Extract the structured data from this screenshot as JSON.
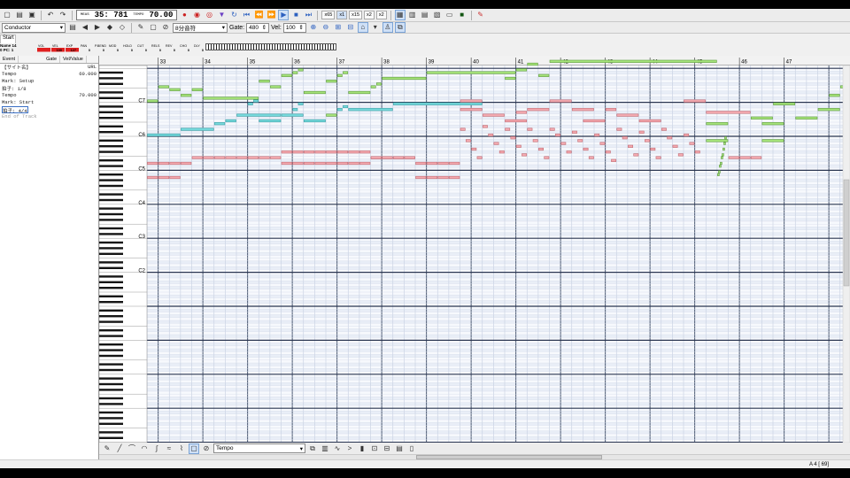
{
  "toolbar": {
    "meas_label": "MEAS",
    "position": "35: 781",
    "tempo_label": "TEMPO",
    "tempo": "70.00",
    "zoom_buttons": [
      "x65",
      "x1",
      "x15",
      "x2",
      "x2"
    ],
    "record_color": "#cc2222"
  },
  "toolbar2": {
    "track_select": "Conductor",
    "note_length": "8分音符",
    "gate_label": "Gate:",
    "gate_value": "480",
    "vel_label": "Vel:",
    "vel_value": "100"
  },
  "tabs": {
    "start": "Start"
  },
  "track_info": {
    "name_label": "Name 14",
    "port_label": "0 PC:",
    "port_value": "1",
    "columns": [
      "VOL",
      "VEL",
      "EXP",
      "PAN",
      "P.BEND",
      "MOD",
      "HOLD",
      "CUT",
      "RELS",
      "REV",
      "CHO",
      "DLY"
    ],
    "values": [
      "",
      "100",
      "127",
      "0",
      "0",
      "0",
      "0",
      "0",
      "0",
      "0",
      "0",
      "0"
    ],
    "accent": "#e02020"
  },
  "event_list": {
    "headers": [
      "Event",
      "Gate",
      "Vel/Value"
    ],
    "events": [
      {
        "name": "【サイト名】",
        "value": "URL"
      },
      {
        "name": "Tempo",
        "value": "60.000"
      },
      {
        "name": "Mark: Setup",
        "value": ""
      },
      {
        "name": "拍子: 1/8",
        "value": ""
      },
      {
        "name": "Tempo",
        "value": "70.000"
      },
      {
        "name": "Mark: Start",
        "value": ""
      },
      {
        "name": "拍子: 4/4",
        "value": "",
        "selected": true
      },
      {
        "name": "End of Track",
        "value": "",
        "dim": true
      }
    ]
  },
  "ruler": {
    "measures": [
      "33",
      "34",
      "35",
      "36",
      "37",
      "38",
      "39",
      "40",
      "41",
      "42",
      "43",
      "44",
      "45",
      "46",
      "47"
    ]
  },
  "octave_labels": [
    "C7",
    "C6",
    "C5",
    "C4",
    "C3",
    "C2"
  ],
  "colors": {
    "green": "#a6e37a",
    "cyan": "#77d9dc",
    "pink": "#f4aab0",
    "grid_bg": "#f7f9fd",
    "selected_note": "#e8e04a"
  },
  "notes": [
    {
      "p": 84,
      "s": 32.75,
      "e": 33.5,
      "c": "c"
    },
    {
      "p": 86,
      "s": 33.5,
      "e": 34.25,
      "c": "c"
    },
    {
      "p": 88,
      "s": 34.25,
      "e": 34.5,
      "c": "c"
    },
    {
      "p": 89,
      "s": 34.5,
      "e": 34.75,
      "c": "c"
    },
    {
      "p": 91,
      "s": 34.75,
      "e": 35.75,
      "c": "c"
    },
    {
      "p": 95,
      "s": 35,
      "e": 35.125,
      "c": "c"
    },
    {
      "p": 96,
      "s": 35.125,
      "e": 35.25,
      "c": "c"
    },
    {
      "p": 89,
      "s": 35.25,
      "e": 35.75,
      "c": "c"
    },
    {
      "p": 91,
      "s": 35.75,
      "e": 36.25,
      "c": "c"
    },
    {
      "p": 93,
      "s": 36,
      "e": 36.125,
      "c": "c"
    },
    {
      "p": 95,
      "s": 36.125,
      "e": 36.25,
      "c": "c"
    },
    {
      "p": 89,
      "s": 36.25,
      "e": 36.75,
      "c": "c"
    },
    {
      "p": 91,
      "s": 36.75,
      "e": 37
    },
    {
      "p": 93,
      "s": 37,
      "e": 37.125,
      "c": "c"
    },
    {
      "p": 94,
      "s": 37.125,
      "e": 37.25,
      "c": "c"
    },
    {
      "p": 93,
      "s": 37.25,
      "e": 38.25,
      "c": "c"
    },
    {
      "p": 95,
      "s": 38.25,
      "e": 40.25,
      "c": "c"
    },
    {
      "p": 96,
      "s": 32.75,
      "e": 33,
      "c": "g"
    },
    {
      "p": 101,
      "s": 33,
      "e": 33.25,
      "c": "g"
    },
    {
      "p": 100,
      "s": 33.25,
      "e": 33.5,
      "c": "g"
    },
    {
      "p": 98,
      "s": 33.5,
      "e": 33.75,
      "c": "g"
    },
    {
      "p": 100,
      "s": 33.75,
      "e": 34,
      "c": "g"
    },
    {
      "p": 97,
      "s": 34,
      "e": 35.25,
      "c": "g"
    },
    {
      "p": 103,
      "s": 35.25,
      "e": 35.5,
      "c": "g"
    },
    {
      "p": 101,
      "s": 35.5,
      "e": 35.75,
      "c": "g"
    },
    {
      "p": 105,
      "s": 35.75,
      "e": 36,
      "c": "g"
    },
    {
      "p": 106,
      "s": 36,
      "e": 36.125,
      "c": "g"
    },
    {
      "p": 107,
      "s": 36.125,
      "e": 36.25,
      "c": "g"
    },
    {
      "p": 99,
      "s": 36.25,
      "e": 36.75,
      "c": "g"
    },
    {
      "p": 103,
      "s": 36.75,
      "e": 37,
      "c": "g"
    },
    {
      "p": 105,
      "s": 37,
      "e": 37.125,
      "c": "g"
    },
    {
      "p": 106,
      "s": 37.125,
      "e": 37.25,
      "c": "g"
    },
    {
      "p": 99,
      "s": 37.25,
      "e": 37.75,
      "c": "g"
    },
    {
      "p": 101,
      "s": 37.75,
      "e": 37.875,
      "c": "g"
    },
    {
      "p": 102,
      "s": 37.875,
      "e": 38,
      "c": "g"
    },
    {
      "p": 104,
      "s": 38,
      "e": 39,
      "c": "g"
    },
    {
      "p": 106,
      "s": 39,
      "e": 41,
      "c": "g"
    },
    {
      "p": 104,
      "s": 40.75,
      "e": 41,
      "c": "g"
    },
    {
      "p": 107,
      "s": 41,
      "e": 41.25,
      "c": "g"
    },
    {
      "p": 109,
      "s": 41.25,
      "e": 41.5,
      "c": "g"
    },
    {
      "p": 105,
      "s": 41.5,
      "e": 41.75,
      "c": "g"
    },
    {
      "p": 110,
      "s": 41.75,
      "e": 45.5,
      "c": "g"
    },
    {
      "p": 95,
      "s": 46.75,
      "e": 47.25,
      "c": "g"
    },
    {
      "p": 93,
      "s": 47.75,
      "e": 48.25,
      "c": "g"
    },
    {
      "p": 90,
      "s": 46.25,
      "e": 46.75,
      "c": "g"
    },
    {
      "p": 90,
      "s": 47.25,
      "e": 47.75,
      "c": "g"
    },
    {
      "p": 88,
      "s": 45.25,
      "e": 45.75,
      "c": "g"
    },
    {
      "p": 88,
      "s": 46.5,
      "e": 47,
      "c": "g"
    },
    {
      "p": 82,
      "s": 45.25,
      "e": 45.75,
      "c": "g"
    },
    {
      "p": 82,
      "s": 46.5,
      "e": 47,
      "c": "g"
    },
    {
      "p": 98,
      "s": 48,
      "e": 48.25,
      "c": "g"
    },
    {
      "p": 101,
      "s": 48.25,
      "e": 48.5,
      "c": "g"
    },
    {
      "p": 104,
      "s": 48.5,
      "e": 48.75,
      "c": "g"
    },
    {
      "p": 108,
      "s": 48.5,
      "e": 48.75,
      "c": "g"
    },
    {
      "p": 74,
      "s": 32.75,
      "e": 33.75,
      "c": "p"
    },
    {
      "p": 76,
      "s": 33.75,
      "e": 35.75,
      "c": "p"
    },
    {
      "p": 74,
      "s": 35.75,
      "e": 37.75,
      "c": "p"
    },
    {
      "p": 76,
      "s": 37.75,
      "e": 38.75,
      "c": "p"
    },
    {
      "p": 74,
      "s": 38.75,
      "e": 39.75,
      "c": "p"
    },
    {
      "p": 69,
      "s": 32.75,
      "e": 33.5,
      "c": "p"
    },
    {
      "p": 69,
      "s": 38.75,
      "e": 39.75,
      "c": "p"
    },
    {
      "p": 78,
      "s": 35.75,
      "e": 37.75,
      "c": "p"
    },
    {
      "p": 76,
      "s": 37.75,
      "e": 38.75,
      "c": "p"
    },
    {
      "p": 96,
      "s": 39.75,
      "e": 40.25,
      "c": "p"
    },
    {
      "p": 93,
      "s": 39.75,
      "e": 40.25,
      "c": "p"
    },
    {
      "p": 91,
      "s": 40.25,
      "e": 40.75,
      "c": "p"
    },
    {
      "p": 89,
      "s": 40.75,
      "e": 41.25,
      "c": "p"
    },
    {
      "p": 92,
      "s": 41,
      "e": 41.25,
      "c": "p"
    },
    {
      "p": 93,
      "s": 41.25,
      "e": 41.75,
      "c": "p"
    },
    {
      "p": 96,
      "s": 41.75,
      "e": 42.25,
      "c": "p"
    },
    {
      "p": 93,
      "s": 42.25,
      "e": 42.75,
      "c": "p"
    },
    {
      "p": 89,
      "s": 42.5,
      "e": 43,
      "c": "p"
    },
    {
      "p": 93,
      "s": 43,
      "e": 43.25,
      "c": "p"
    },
    {
      "p": 91,
      "s": 43.25,
      "e": 43.75,
      "c": "p"
    },
    {
      "p": 89,
      "s": 43.75,
      "e": 44.25,
      "c": "p"
    },
    {
      "p": 96,
      "s": 44.75,
      "e": 45.25,
      "c": "p"
    },
    {
      "p": 92,
      "s": 45.25,
      "e": 46.25,
      "c": "p"
    },
    {
      "p": 76,
      "s": 45.75,
      "e": 46.5,
      "c": "p"
    }
  ],
  "chords": [
    {
      "s": 39.75,
      "p": [
        86,
        82,
        79,
        76
      ]
    },
    {
      "s": 40.25,
      "p": [
        87,
        84,
        81,
        78
      ]
    },
    {
      "s": 40.75,
      "p": [
        86,
        83,
        80,
        77
      ]
    },
    {
      "s": 41.25,
      "p": [
        86,
        82,
        79,
        76
      ]
    },
    {
      "s": 41.75,
      "p": [
        86,
        84,
        81,
        78
      ]
    },
    {
      "s": 42.25,
      "p": [
        85,
        82,
        79,
        76
      ]
    },
    {
      "s": 42.75,
      "p": [
        84,
        81,
        78,
        75
      ]
    },
    {
      "s": 43.25,
      "p": [
        86,
        83,
        80,
        77
      ]
    },
    {
      "s": 43.75,
      "p": [
        85,
        82,
        79,
        76
      ]
    },
    {
      "s": 44.25,
      "p": [
        86,
        83,
        80,
        77
      ]
    },
    {
      "s": 44.75,
      "p": [
        84,
        81,
        78
      ]
    }
  ],
  "glissando": {
    "s": 45.5,
    "p": [
      70,
      71,
      73,
      74,
      76,
      77,
      79,
      81,
      83
    ]
  },
  "bottom_tools": {
    "controller_select": "Tempo"
  },
  "status": {
    "text": "A 4 [ 69]"
  }
}
